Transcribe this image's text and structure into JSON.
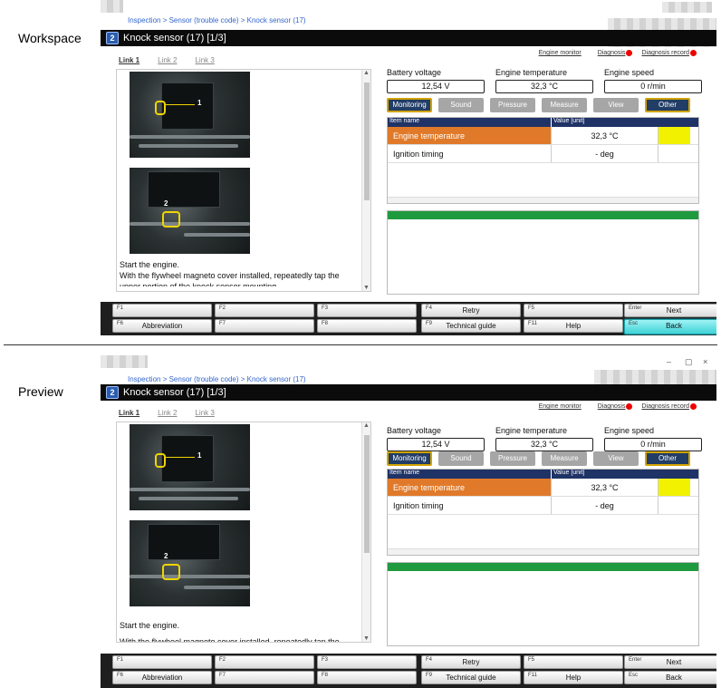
{
  "labels": {
    "workspace": "Workspace",
    "preview": "Preview"
  },
  "colors": {
    "title_bg": "#0b0b0b",
    "header_bg": "#1f3366",
    "orange": "#e07a2a",
    "yellow": "#f2f200",
    "graph_green": "#1f9a3e",
    "back_cyan": "#3ed2d6"
  },
  "window": {
    "minimize_icon": "–",
    "maximize_icon": "▢",
    "close_icon": "×"
  },
  "breadcrumb": "Inspection > Sensor (trouble code) > Knock sensor (17)",
  "title": "Knock sensor (17) [1/3]",
  "logo_icon": "2",
  "top_links": {
    "engine_monitor": "Engine monitor",
    "diagnosis": "Diagnosis",
    "diagnosis_record": "Diagnosis record"
  },
  "tabs": [
    "Link 1",
    "Link 2",
    "Link 3"
  ],
  "photo_callouts": [
    "1",
    "2"
  ],
  "instructions": {
    "line1": "Start the engine.",
    "line2": "With the flywheel magneto cover installed, repeatedly tap the",
    "line3": "upper portion of the knock sensor mounting"
  },
  "params": [
    {
      "label": "Battery voltage",
      "value": "12,54 V"
    },
    {
      "label": "Engine temperature",
      "value": "32,3 °C"
    },
    {
      "label": "Engine speed",
      "value": "0 r/min"
    }
  ],
  "modes": [
    "Monitoring",
    "Sound",
    "Pressure",
    "Measure",
    "View",
    "Other"
  ],
  "table": {
    "col_name": "Item name",
    "col_value": "Value [unit]",
    "rows": [
      {
        "name": "Engine temperature",
        "value": "32,3 °C"
      },
      {
        "name": "Ignition timing",
        "value": "- deg"
      }
    ]
  },
  "fkeys": {
    "f1": "F1",
    "f2": "F2",
    "f3": "F3",
    "f4": "F4",
    "f5": "F5",
    "f6": "F6",
    "f7": "F7",
    "f8": "F8",
    "f9": "F9",
    "f11": "F11",
    "enter": "Enter",
    "esc": "Esc",
    "retry": "Retry",
    "next": "Next",
    "abbreviation": "Abbreviation",
    "technical_guide": "Technical guide",
    "help": "Help",
    "back": "Back"
  }
}
